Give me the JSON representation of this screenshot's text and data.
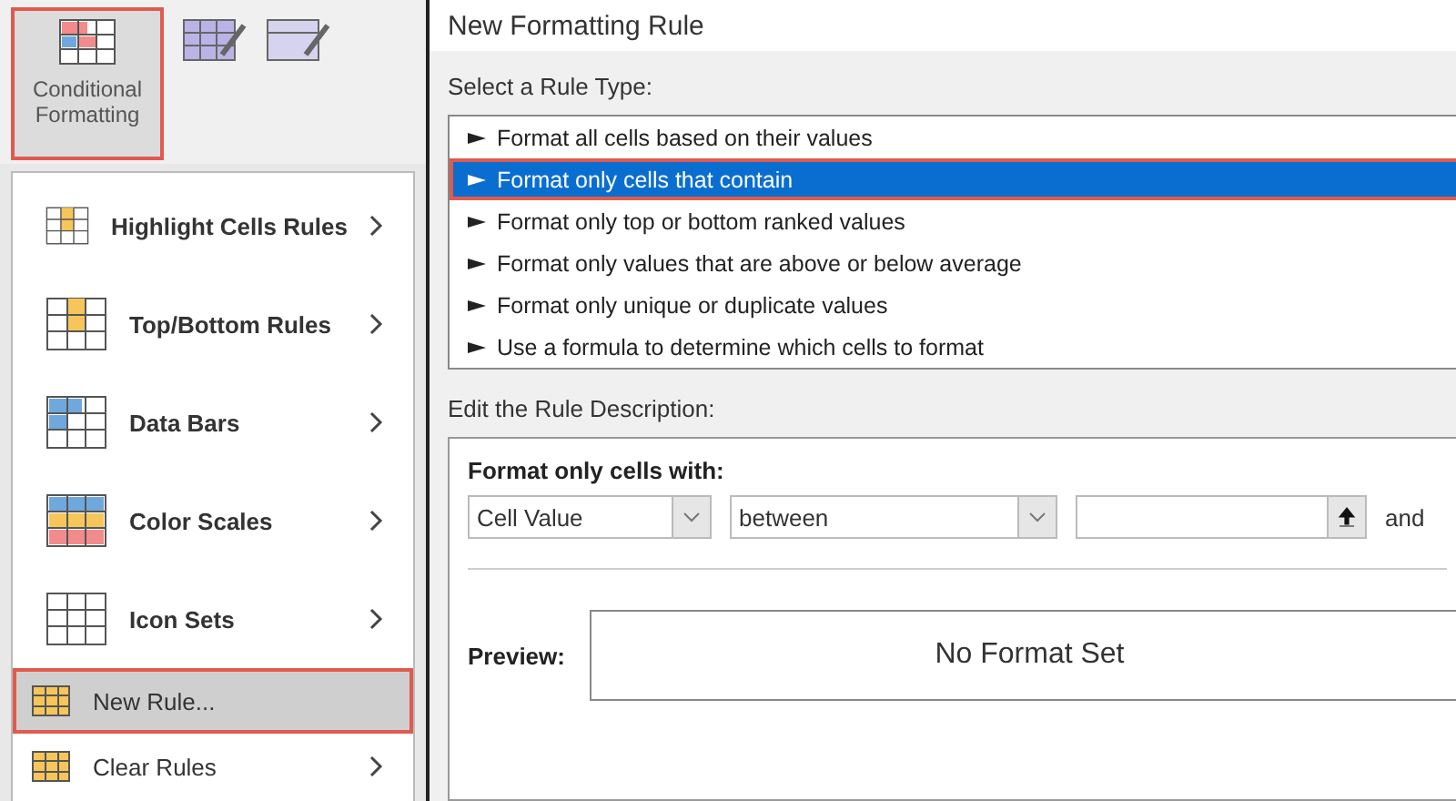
{
  "ribbon": {
    "button": {
      "label": "Conditional Formatting",
      "highlighted": true
    }
  },
  "menu": {
    "items": [
      {
        "label": "Highlight Cells Rules",
        "kind": "large",
        "submenu": true,
        "highlighted": false
      },
      {
        "label": "Top/Bottom Rules",
        "kind": "large",
        "submenu": true,
        "highlighted": false
      },
      {
        "label": "Data Bars",
        "kind": "large",
        "submenu": true,
        "highlighted": false
      },
      {
        "label": "Color Scales",
        "kind": "large",
        "submenu": true,
        "highlighted": false
      },
      {
        "label": "Icon Sets",
        "kind": "large",
        "submenu": true,
        "highlighted": false
      },
      {
        "label": "New Rule...",
        "kind": "small",
        "submenu": false,
        "highlighted": true
      },
      {
        "label": "Clear Rules",
        "kind": "small",
        "submenu": true,
        "highlighted": false
      }
    ]
  },
  "dialog": {
    "title": "New Formatting Rule",
    "rule_type_label": "Select a Rule Type:",
    "rule_types": [
      {
        "label": "Format all cells based on their values",
        "selected": false
      },
      {
        "label": "Format only cells that contain",
        "selected": true
      },
      {
        "label": "Format only top or bottom ranked values",
        "selected": false
      },
      {
        "label": "Format only values that are above or below average",
        "selected": false
      },
      {
        "label": "Format only unique or duplicate values",
        "selected": false
      },
      {
        "label": "Use a formula to determine which cells to format",
        "selected": false
      }
    ],
    "description_label": "Edit the Rule Description:",
    "format_heading": "Format only cells with:",
    "condition_field": "Cell Value",
    "operator_field": "between",
    "and_label": "and",
    "preview_label": "Preview:",
    "preview_text": "No Format Set"
  }
}
